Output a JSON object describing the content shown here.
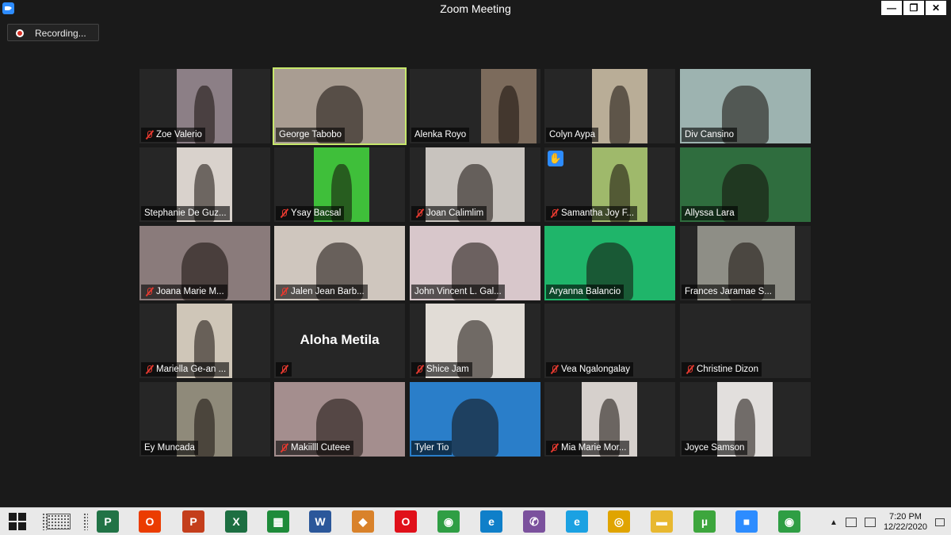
{
  "window": {
    "title": "Zoom Meeting",
    "buttons": [
      "—",
      "❐",
      "✕"
    ]
  },
  "recording": {
    "label": "Recording..."
  },
  "featured_tile": {
    "name": "Aloha Metila"
  },
  "participants": [
    {
      "name": "Zoe Valerio",
      "muted": true,
      "video": true,
      "bg": "#8c7f86"
    },
    {
      "name": "George Tabobo",
      "muted": false,
      "video": true,
      "active": true,
      "bg": "#a99d92"
    },
    {
      "name": "Alenka Royo",
      "muted": false,
      "video": true,
      "bg": "#7c6b5c"
    },
    {
      "name": "Colyn Aypa",
      "muted": false,
      "video": true,
      "bg": "#b9ad97"
    },
    {
      "name": "Div Cansino",
      "muted": false,
      "video": true,
      "bg": "#9db3b0"
    },
    {
      "name": "Stephanie De Guz...",
      "muted": false,
      "video": true,
      "bg": "#d9d2cc"
    },
    {
      "name": "Ysay Bacsal",
      "muted": true,
      "video": true,
      "bg": "#3fbf3a"
    },
    {
      "name": "Joan Calimlim",
      "muted": true,
      "video": true,
      "bg": "#c8c3be"
    },
    {
      "name": "Samantha Joy F...",
      "muted": true,
      "video": true,
      "hand": true,
      "bg": "#9fb96b"
    },
    {
      "name": "Allyssa Lara",
      "muted": false,
      "video": true,
      "bg": "#2f6d3e"
    },
    {
      "name": "Joana Marie M...",
      "muted": true,
      "video": true,
      "bg": "#8a7b7b"
    },
    {
      "name": "Jalen Jean Barb...",
      "muted": true,
      "video": true,
      "bg": "#cfc6be"
    },
    {
      "name": "John Vincent L. Gal...",
      "muted": false,
      "video": true,
      "bg": "#d8c7cb"
    },
    {
      "name": "Aryanna Balancio",
      "muted": false,
      "video": true,
      "bg": "#1fb56a"
    },
    {
      "name": "Frances Jaramae S...",
      "muted": false,
      "video": true,
      "bg": "#8e8e86"
    },
    {
      "name": "Mariella Ge-an ...",
      "muted": true,
      "video": true,
      "bg": "#cfc6b8"
    },
    {
      "name": "",
      "muted": true,
      "video": false,
      "bg": "#262626"
    },
    {
      "name": "Shice Jam",
      "muted": true,
      "video": true,
      "bg": "#e1dcd6"
    },
    {
      "name": "Vea Ngalongalay",
      "muted": true,
      "video": false,
      "bg": "#262626"
    },
    {
      "name": "Christine Dizon",
      "muted": true,
      "video": false,
      "bg": "#262626"
    },
    {
      "name": "Ey Muncada",
      "muted": false,
      "video": true,
      "bg": "#8f8a7a"
    },
    {
      "name": "Makiilll Cuteee",
      "muted": true,
      "video": true,
      "bg": "#a48e8e"
    },
    {
      "name": "Tyler Tio",
      "muted": false,
      "video": true,
      "bg": "#2a7ec9"
    },
    {
      "name": "Mia Marie Mor...",
      "muted": true,
      "video": true,
      "bg": "#d6d0cc"
    },
    {
      "name": "Joyce Samson",
      "muted": false,
      "video": true,
      "bg": "#e2dfdd"
    }
  ],
  "taskbar": {
    "apps": [
      {
        "name": "project-icon",
        "label": "P",
        "color": "#217346"
      },
      {
        "name": "office-icon",
        "label": "O",
        "color": "#eb3c00"
      },
      {
        "name": "powerpoint-icon",
        "label": "P",
        "color": "#c43e1c"
      },
      {
        "name": "excel-icon",
        "label": "X",
        "color": "#1d6f42"
      },
      {
        "name": "store-icon",
        "label": "▦",
        "color": "#1e8b3a"
      },
      {
        "name": "word-icon",
        "label": "W",
        "color": "#2b579a"
      },
      {
        "name": "fox-app-icon",
        "label": "◆",
        "color": "#d9822b"
      },
      {
        "name": "opera-icon",
        "label": "O",
        "color": "#e0101a"
      },
      {
        "name": "chrome-icon",
        "label": "◉",
        "color": "#2f9e44"
      },
      {
        "name": "edge-icon",
        "label": "e",
        "color": "#0f7fc9"
      },
      {
        "name": "viber-icon",
        "label": "✆",
        "color": "#7b519d"
      },
      {
        "name": "internet-explorer-icon",
        "label": "e",
        "color": "#1ba1e2"
      },
      {
        "name": "vpn-icon",
        "label": "◎",
        "color": "#e0a400"
      },
      {
        "name": "file-explorer-icon",
        "label": "▬",
        "color": "#e8b830"
      },
      {
        "name": "utorrent-icon",
        "label": "µ",
        "color": "#3da63d"
      },
      {
        "name": "zoom-icon",
        "label": "■",
        "color": "#2d8cff"
      },
      {
        "name": "chrome-2-icon",
        "label": "◉",
        "color": "#2f9e44"
      }
    ],
    "time": "7:20 PM",
    "date": "12/22/2020"
  }
}
